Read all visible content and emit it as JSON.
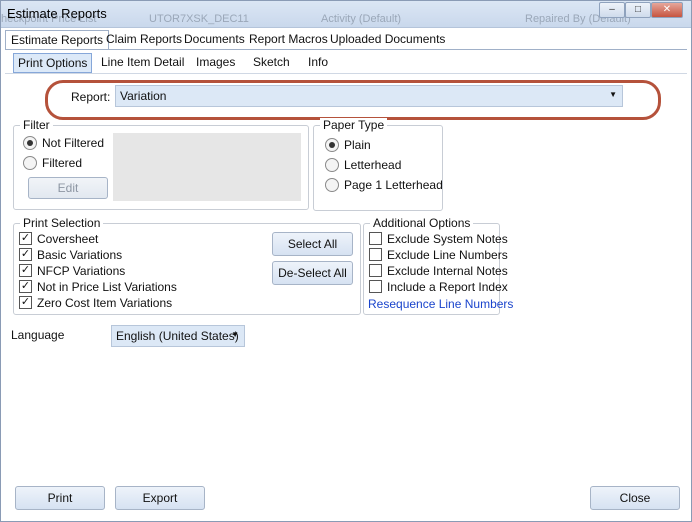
{
  "window": {
    "title": "Estimate Reports",
    "background_ghost": [
      "heckpoint Price List",
      "UTOR7XSK_DEC11",
      "Activity (Default)",
      "Repaired By (Default)"
    ]
  },
  "main_tabs": [
    {
      "label": "Estimate Reports",
      "active": true
    },
    {
      "label": "Claim Reports",
      "active": false
    },
    {
      "label": "Documents",
      "active": false
    },
    {
      "label": "Report Macros",
      "active": false
    },
    {
      "label": "Uploaded Documents",
      "active": false
    }
  ],
  "sub_tabs": [
    {
      "label": "Print Options",
      "active": true
    },
    {
      "label": "Line Item Detail",
      "active": false
    },
    {
      "label": "Images",
      "active": false
    },
    {
      "label": "Sketch",
      "active": false
    },
    {
      "label": "Info",
      "active": false
    }
  ],
  "report": {
    "label": "Report:",
    "value": "Variation"
  },
  "filter": {
    "title": "Filter",
    "options": [
      {
        "label": "Not Filtered",
        "selected": true
      },
      {
        "label": "Filtered",
        "selected": false
      }
    ],
    "edit_label": "Edit"
  },
  "paper_type": {
    "title": "Paper Type",
    "options": [
      {
        "label": "Plain",
        "selected": true
      },
      {
        "label": "Letterhead",
        "selected": false
      },
      {
        "label": "Page 1 Letterhead",
        "selected": false
      }
    ]
  },
  "print_selection": {
    "title": "Print Selection",
    "items": [
      {
        "label": "Coversheet",
        "checked": true
      },
      {
        "label": "Basic Variations",
        "checked": true
      },
      {
        "label": "NFCP Variations",
        "checked": true
      },
      {
        "label": "Not in Price List Variations",
        "checked": true
      },
      {
        "label": "Zero Cost Item Variations",
        "checked": true
      }
    ],
    "select_all_label": "Select All",
    "deselect_all_label": "De-Select All"
  },
  "additional_options": {
    "title": "Additional Options",
    "items": [
      {
        "label": "Exclude System Notes",
        "checked": false
      },
      {
        "label": "Exclude Line Numbers",
        "checked": false
      },
      {
        "label": "Exclude Internal Notes",
        "checked": false
      },
      {
        "label": "Include a Report Index",
        "checked": false
      }
    ],
    "resequence_label": "Resequence Line Numbers"
  },
  "language": {
    "label": "Language",
    "value": "English (United States)"
  },
  "footer": {
    "print_label": "Print",
    "export_label": "Export",
    "close_label": "Close"
  },
  "colors": {
    "highlight_oval": "#b5523b",
    "link": "#1a44cc",
    "active_tab": "#dce9f8"
  }
}
